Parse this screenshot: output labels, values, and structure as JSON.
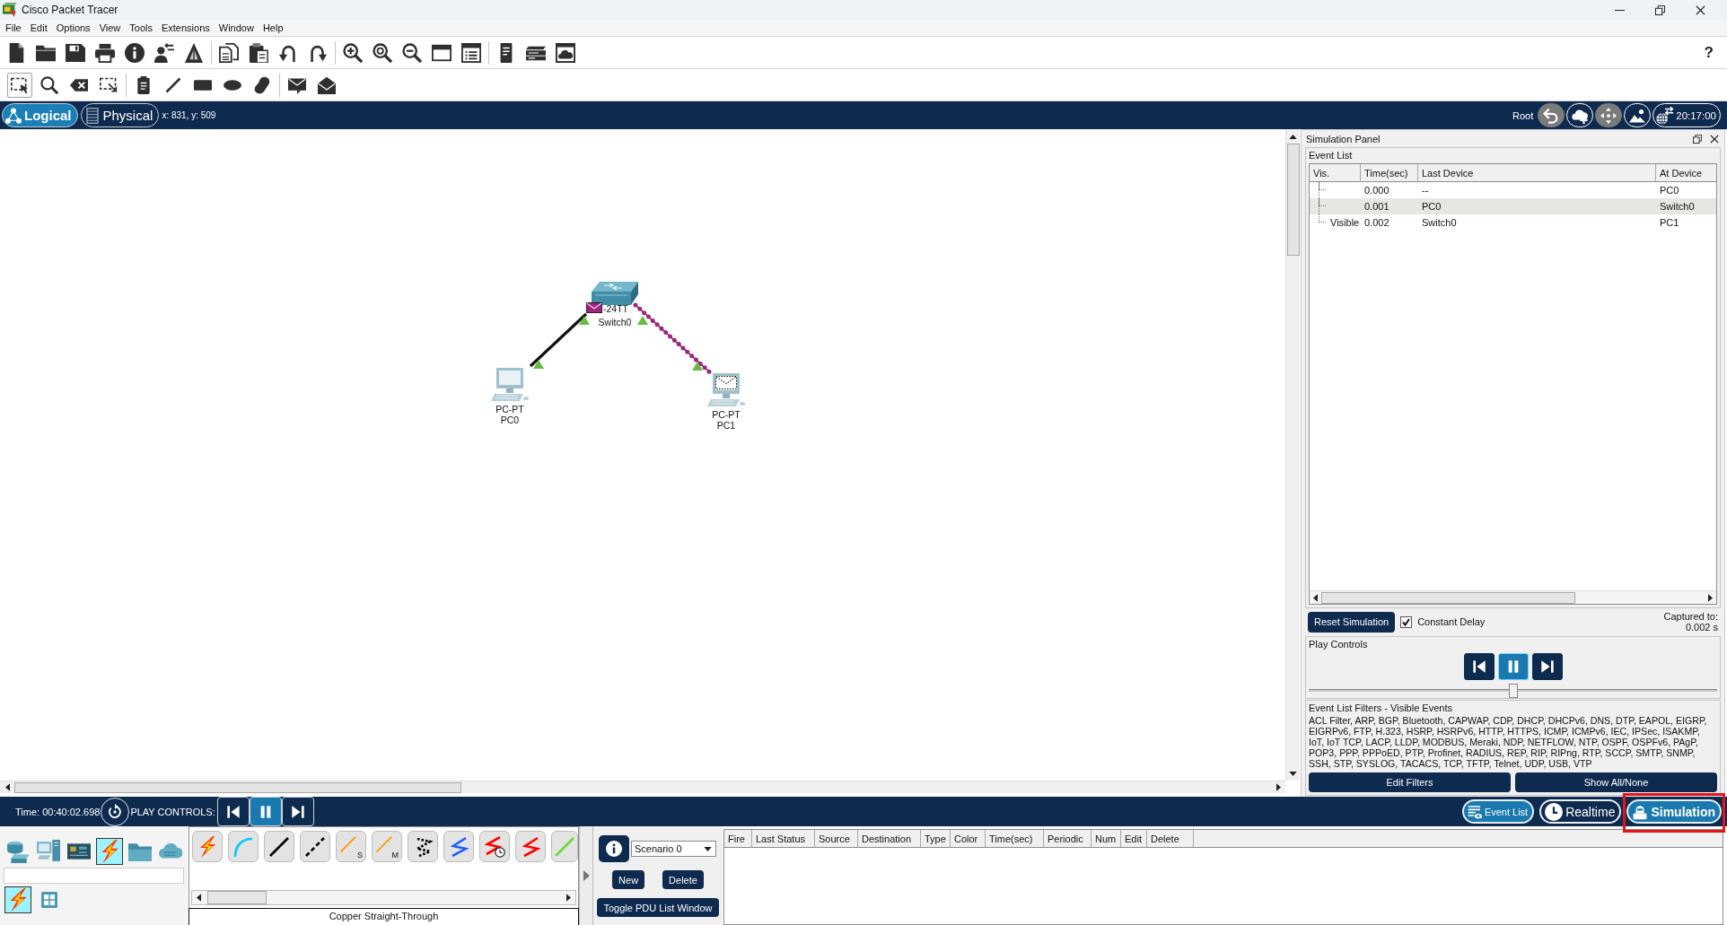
{
  "window": {
    "title": "Cisco Packet Tracer"
  },
  "menu": [
    "File",
    "Edit",
    "Options",
    "View",
    "Tools",
    "Extensions",
    "Window",
    "Help"
  ],
  "toolbar": {
    "help": "?"
  },
  "edit_tools": [
    {
      "kind": "select",
      "selected": true
    },
    {
      "kind": "inspect",
      "selected": false
    },
    {
      "kind": "delete",
      "selected": false
    },
    {
      "kind": "resize",
      "selected": false
    },
    {
      "kind": "note",
      "selected": false
    },
    {
      "kind": "line",
      "selected": false
    },
    {
      "kind": "rectangle",
      "selected": false
    },
    {
      "kind": "ellipse",
      "selected": false
    },
    {
      "kind": "freeform",
      "selected": false
    },
    {
      "kind": "envelope",
      "selected": false
    },
    {
      "kind": "open",
      "selected": false
    }
  ],
  "workspace_bar": {
    "tabs": [
      {
        "kind": "logical",
        "label": "Logical",
        "selected": true
      },
      {
        "kind": "physical",
        "label": "Physical",
        "selected": false
      }
    ],
    "coordinates": "x: 831, y: 509",
    "location": "Root",
    "nav_buttons": [
      {
        "kind": "back",
        "disabled": true
      },
      {
        "kind": "cloud",
        "disabled": false
      },
      {
        "kind": "move",
        "disabled": true
      },
      {
        "kind": "image",
        "disabled": false
      }
    ],
    "clock": "20:17:00"
  },
  "workspace": {
    "devices": [
      {
        "kind": "switch",
        "model": "-24TT",
        "name": "Switch0",
        "pdu": true,
        "incoming_pdu": false
      },
      {
        "kind": "pc",
        "model": "PC-PT",
        "name": "PC0",
        "pdu": false,
        "incoming_pdu": false
      },
      {
        "kind": "pc",
        "model": "PC-PT",
        "name": "PC1",
        "pdu": false,
        "incoming_pdu": true
      }
    ],
    "links": [
      {
        "up": true,
        "pdu": false
      },
      {
        "up": true,
        "pdu": true
      }
    ]
  },
  "simulation_panel": {
    "title": "Simulation Panel",
    "event_list": {
      "title": "Event List",
      "columns": [
        "Vis.",
        "Time(sec)",
        "Last Device",
        "At Device"
      ],
      "rows": [
        {
          "time": "0.000",
          "last_device": "--",
          "at_device": "PC0",
          "selected": false
        },
        {
          "time": "0.001",
          "last_device": "PC0",
          "at_device": "Switch0",
          "selected": true
        },
        {
          "vis": "Visible",
          "time": "0.002",
          "last_device": "Switch0",
          "at_device": "PC1",
          "selected": false
        }
      ]
    },
    "reset_button": "Reset Simulation",
    "constant_delay": {
      "label": "Constant Delay",
      "checked": true
    },
    "captured_label": "Captured to:",
    "captured_value": "0.002 s",
    "play_controls": {
      "title": "Play Controls",
      "buttons": [
        {
          "kind": "back",
          "selected": false
        },
        {
          "kind": "pause",
          "selected": true
        },
        {
          "kind": "forward",
          "selected": false
        }
      ],
      "level": 0.5
    },
    "filters": {
      "title": "Event List Filters - Visible Events",
      "protocols": "ACL Filter, ARP, BGP, Bluetooth, CAPWAP, CDP, DHCP, DHCPv6, DNS, DTP, EAPOL, EIGRP, EIGRPv6, FTP, H.323, HSRP, HSRPv6, HTTP, HTTPS, ICMP, ICMPv6, IEC, IPSec, ISAKMP, IoT, IoT TCP, LACP, LLDP, MODBUS, Meraki, NDP, NETFLOW, NTP, OSPF, OSPFv6, PAgP, POP3, PPP, PPPoED, PTP, Profinet, RADIUS, REP, RIP, RIPng, RTP, SCCP, SMTP, SNMP, SSH, STP, SYSLOG, TACACS, TCP, TFTP, Telnet, UDP, USB, VTP",
      "buttons": [
        "Edit Filters",
        "Show All/None"
      ]
    }
  },
  "bottom_bar": {
    "time": "Time: 00:40:02.698",
    "play_label": "PLAY CONTROLS:",
    "play_buttons": [
      {
        "kind": "back",
        "selected": false
      },
      {
        "kind": "pause",
        "selected": true
      },
      {
        "kind": "forward",
        "selected": false
      }
    ],
    "mode_buttons": [
      {
        "kind": "events",
        "label": "Event List",
        "selected": true,
        "highlighted": false
      },
      {
        "kind": "realtime",
        "label": "Realtime",
        "selected": false,
        "highlighted": false
      },
      {
        "kind": "simulation",
        "label": "Simulation",
        "selected": true,
        "highlighted": true
      }
    ]
  },
  "device_panel": {
    "categories": [
      {
        "kind": "router",
        "selected": false
      },
      {
        "kind": "computer",
        "selected": false
      },
      {
        "kind": "board",
        "selected": false
      },
      {
        "kind": "bolt",
        "selected": true
      },
      {
        "kind": "folder",
        "selected": false
      },
      {
        "kind": "cloud",
        "selected": false
      }
    ],
    "subcategories": [
      {
        "kind": "bolt",
        "selected": true
      },
      {
        "kind": "grid",
        "selected": false
      }
    ],
    "connections": [
      {
        "kind": "bolt"
      },
      {
        "kind": "arc",
        "color": "#00ccff"
      },
      {
        "kind": "solid",
        "color": "#000000"
      },
      {
        "kind": "dashed",
        "color": "#000000"
      },
      {
        "kind": "fiber",
        "color": "#ff9900",
        "tag": "S"
      },
      {
        "kind": "fiber",
        "color": "#ff9900",
        "tag": "M"
      },
      {
        "kind": "dotted",
        "color": "#000000"
      },
      {
        "kind": "zigzag",
        "color": "#1e5eff"
      },
      {
        "kind": "timed",
        "color": "#ff0000"
      },
      {
        "kind": "zigzag",
        "color": "#ff0000"
      },
      {
        "kind": "solid",
        "color": "#66dd33"
      }
    ],
    "connection_label": "Copper Straight-Through"
  },
  "pdu_panel": {
    "scenario": "Scenario 0",
    "buttons": [
      "New",
      "Delete"
    ],
    "toggle_button": "Toggle PDU List Window",
    "columns": [
      "Fire",
      "Last Status",
      "Source",
      "Destination",
      "Type",
      "Color",
      "Time(sec)",
      "Periodic",
      "Num",
      "Edit",
      "Delete"
    ]
  }
}
